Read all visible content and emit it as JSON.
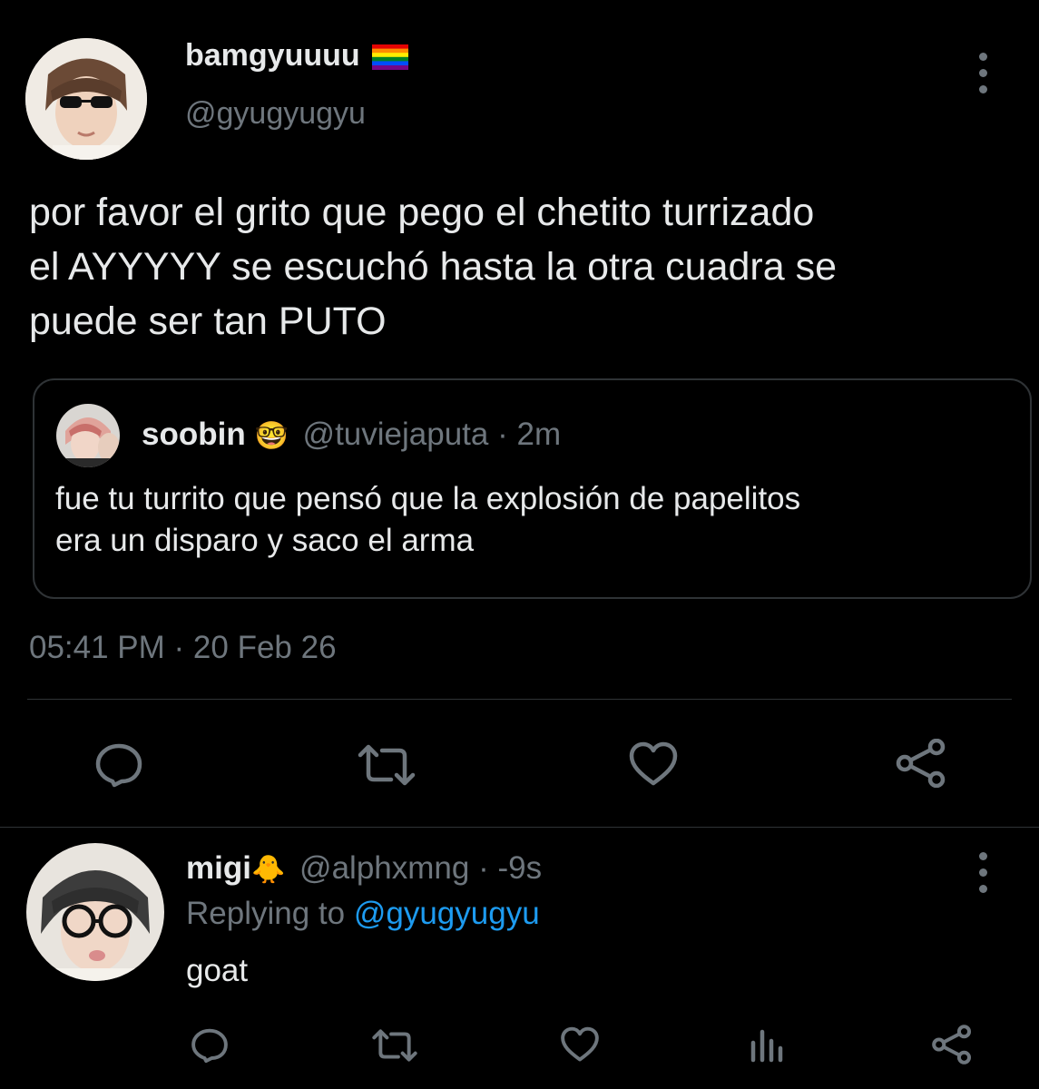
{
  "main_tweet": {
    "display_name": "bamgyuuuu",
    "name_emoji": "rainbow-flag-icon",
    "handle": "@gyugyugyu",
    "text_lines": [
      "por favor el grito que pego el chetito turrizado",
      "el AYYYYY se escuchó hasta la otra cuadra se",
      "puede ser tan PUTO"
    ],
    "timestamp": "05:41 PM · 20 Feb 26"
  },
  "quoted_tweet": {
    "display_name": "soobin",
    "name_emoji": "🤓",
    "handle": "@tuviejaputa",
    "time": "· 2m",
    "text_lines": [
      "fue tu turrito que pensó que la explosión de papelitos",
      "era un disparo y saco el arma"
    ]
  },
  "reply_tweet": {
    "display_name": "migi",
    "name_emoji": "🐥",
    "handle": "@alphxmng",
    "time": "· -9s",
    "replying_prefix": "Replying to",
    "replying_to": "@gyugyugyu",
    "text": "goat"
  },
  "colors": {
    "background": "#000000",
    "text": "#e7e9ea",
    "muted": "#6e767d",
    "link": "#1d9bf0",
    "border": "#2f3336"
  },
  "icons": {
    "main_actions": [
      "reply-icon",
      "retweet-icon",
      "like-icon",
      "share-icon"
    ],
    "reply_actions": [
      "reply-icon",
      "retweet-icon",
      "like-icon",
      "analytics-icon",
      "share-icon"
    ]
  }
}
